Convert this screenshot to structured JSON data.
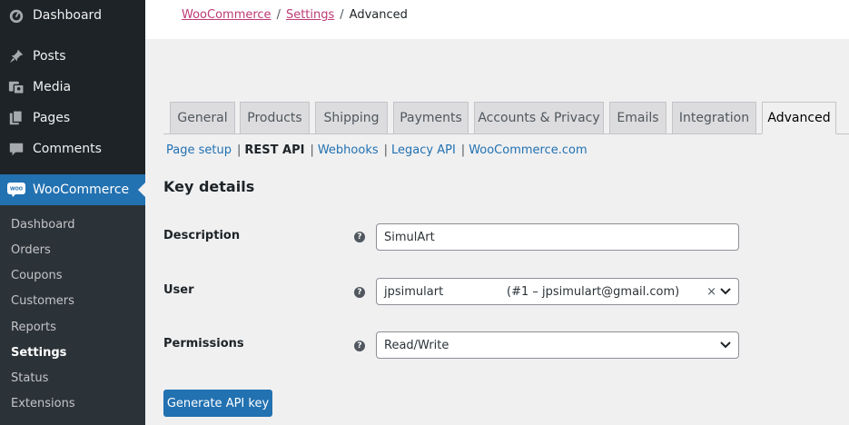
{
  "sidebar": {
    "items": [
      {
        "label": "Dashboard",
        "icon": "dashboard-icon"
      },
      {
        "label": "Posts",
        "icon": "pin-icon"
      },
      {
        "label": "Media",
        "icon": "media-icon"
      },
      {
        "label": "Pages",
        "icon": "pages-icon"
      },
      {
        "label": "Comments",
        "icon": "comment-icon"
      },
      {
        "label": "WooCommerce",
        "icon": "woo-icon",
        "active": true
      }
    ],
    "submenu": [
      "Dashboard",
      "Orders",
      "Coupons",
      "Customers",
      "Reports",
      "Settings",
      "Status",
      "Extensions"
    ],
    "submenu_current": "Settings",
    "woo_badge": "WOO"
  },
  "breadcrumb": {
    "link1": "WooCommerce",
    "link2": "Settings",
    "separator": "/",
    "current": "Advanced"
  },
  "tabs": [
    "General",
    "Products",
    "Shipping",
    "Payments",
    "Accounts & Privacy",
    "Emails",
    "Integration",
    "Advanced"
  ],
  "active_tab": "Advanced",
  "subsub": {
    "items": [
      "Page setup",
      "REST API",
      "Webhooks",
      "Legacy API",
      "WooCommerce.com"
    ],
    "current": "REST API",
    "separator": "|"
  },
  "section_title": "Key details",
  "form": {
    "description": {
      "label": "Description",
      "value": "SimulArt"
    },
    "user": {
      "label": "User",
      "value_name": "jpsimulart",
      "value_detail": "(#1 – jpsimulart@gmail.com)",
      "clear": "×"
    },
    "permissions": {
      "label": "Permissions",
      "value": "Read/Write"
    },
    "help_glyph": "?"
  },
  "generate_button": "Generate API key",
  "colors": {
    "sidebar": "#1d2327",
    "submenu": "#2c3338",
    "accent": "#2271b1",
    "woo_link": "#bd3a76"
  }
}
